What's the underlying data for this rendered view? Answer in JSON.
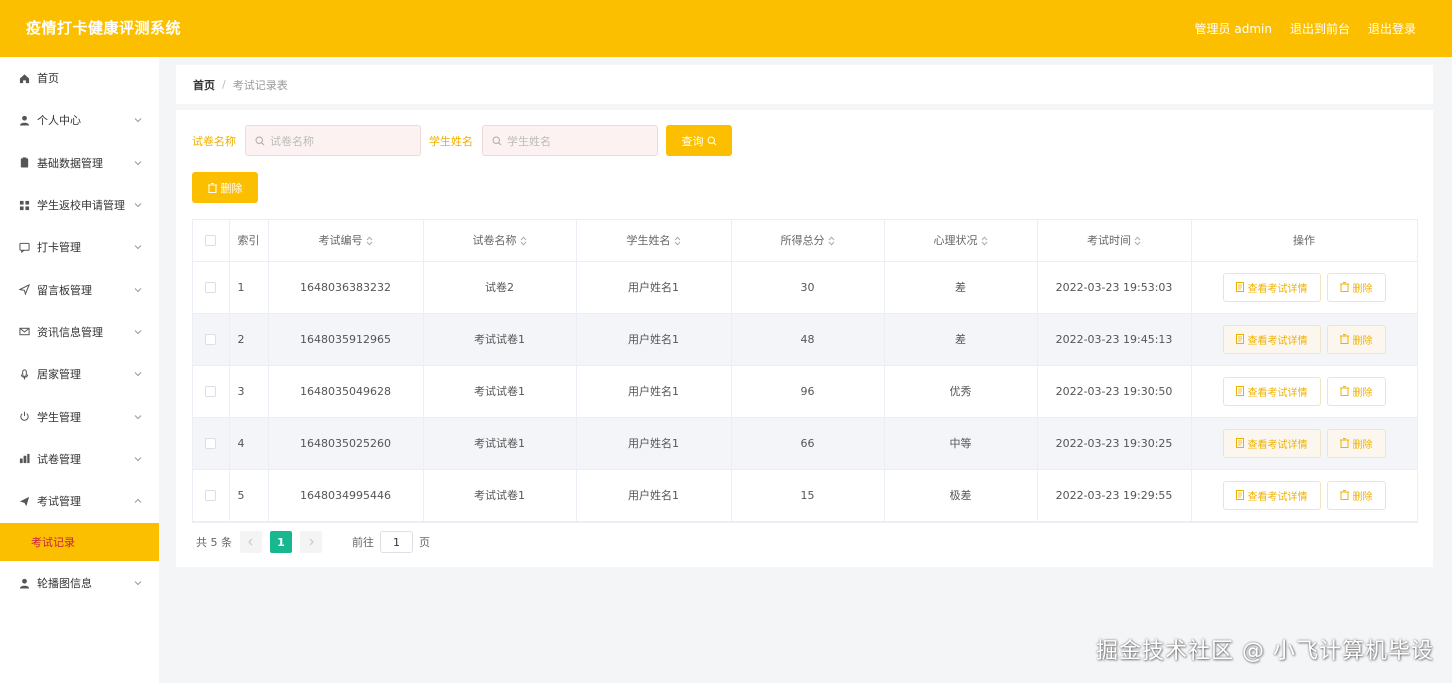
{
  "header": {
    "title": "疫情打卡健康评测系统",
    "admin_label": "管理员 admin",
    "front_label": "退出到前台",
    "logout_label": "退出登录"
  },
  "sidebar": {
    "items": [
      {
        "label": "首页",
        "icon": "home-icon"
      },
      {
        "label": "个人中心",
        "icon": "user-icon"
      },
      {
        "label": "基础数据管理",
        "icon": "clipboard-icon"
      },
      {
        "label": "学生返校申请管理",
        "icon": "grid-icon"
      },
      {
        "label": "打卡管理",
        "icon": "chat-icon"
      },
      {
        "label": "留言板管理",
        "icon": "send-icon"
      },
      {
        "label": "资讯信息管理",
        "icon": "mail-icon"
      },
      {
        "label": "居家管理",
        "icon": "mic-icon"
      },
      {
        "label": "学生管理",
        "icon": "power-icon"
      },
      {
        "label": "试卷管理",
        "icon": "chart-icon"
      },
      {
        "label": "考试管理",
        "icon": "paper-plane-icon"
      },
      {
        "label": "轮播图信息",
        "icon": "user-icon"
      }
    ],
    "active_sub": "考试记录"
  },
  "breadcrumb": {
    "home": "首页",
    "sep": "/",
    "current": "考试记录表"
  },
  "filters": {
    "paper_label": "试卷名称",
    "paper_placeholder": "试卷名称",
    "student_label": "学生姓名",
    "student_placeholder": "学生姓名",
    "query_label": "查询",
    "delete_label": "删除"
  },
  "table": {
    "columns": [
      "索引",
      "考试编号",
      "试卷名称",
      "学生姓名",
      "所得总分",
      "心理状况",
      "考试时间",
      "操作"
    ],
    "view_label": "查看考试详情",
    "delete_label": "删除",
    "rows": [
      {
        "idx": "1",
        "id": "1648036383232",
        "paper": "试卷2",
        "student": "用户姓名1",
        "score": "30",
        "mental": "差",
        "time": "2022-03-23 19:53:03"
      },
      {
        "idx": "2",
        "id": "1648035912965",
        "paper": "考试试卷1",
        "student": "用户姓名1",
        "score": "48",
        "mental": "差",
        "time": "2022-03-23 19:45:13"
      },
      {
        "idx": "3",
        "id": "1648035049628",
        "paper": "考试试卷1",
        "student": "用户姓名1",
        "score": "96",
        "mental": "优秀",
        "time": "2022-03-23 19:30:50"
      },
      {
        "idx": "4",
        "id": "1648035025260",
        "paper": "考试试卷1",
        "student": "用户姓名1",
        "score": "66",
        "mental": "中等",
        "time": "2022-03-23 19:30:25"
      },
      {
        "idx": "5",
        "id": "1648034995446",
        "paper": "考试试卷1",
        "student": "用户姓名1",
        "score": "15",
        "mental": "极差",
        "time": "2022-03-23 19:29:55"
      }
    ]
  },
  "pagination": {
    "total": "共 5 条",
    "current_page": "1",
    "goto_label": "前往",
    "goto_value": "1",
    "page_unit": "页"
  },
  "watermark": "掘金技术社区 @ 小飞计算机毕设",
  "colors": {
    "accent": "#fcbf00",
    "active_sub_text": "#c9203f",
    "page_active": "#17b890"
  }
}
